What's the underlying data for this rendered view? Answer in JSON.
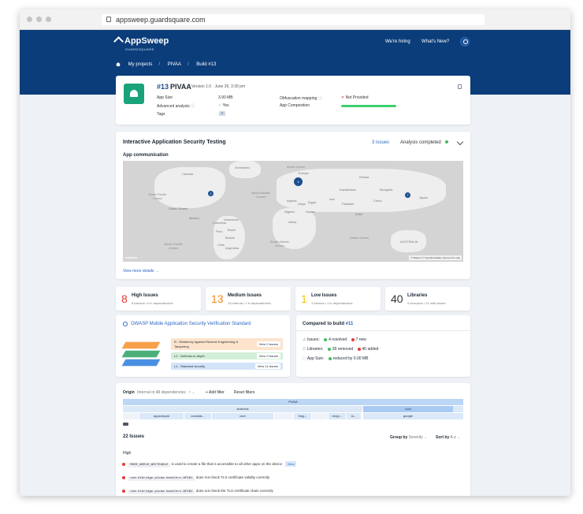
{
  "browser": {
    "url": "appsweep.guardsquare.com"
  },
  "header": {
    "logo": "AppSweep",
    "logo_sub": "GUARDSQUARE",
    "nav_hiring": "We're hiring",
    "nav_whats_new": "What's New?",
    "breadcrumb": [
      "My projects",
      "PIVAA",
      "Build #13"
    ]
  },
  "build": {
    "number": "#13",
    "name": "PIVAA",
    "version": "Version 1.0",
    "date": "June 26, 3:39 pm",
    "app_size_label": "App Size",
    "app_size": "3.90 MB",
    "advanced_label": "Advanced analysis",
    "advanced_value": "Yes",
    "tags_label": "Tags",
    "obf_label": "Obfuscation mapping",
    "obf_value": "Not Provided",
    "composition_label": "App Composition"
  },
  "iast": {
    "title": "Interactive Application Security Testing",
    "issues_link": "3 issues",
    "status": "Analysis completed",
    "subtitle": "App communication",
    "view_more": "View more details →",
    "map_attrib": "© Mapbox © OpenStreetMap Improve this map",
    "map_logo": "mapbox",
    "oceans": [
      "Arctic Ocean",
      "North Pacific Ocean",
      "North Atlantic Ocean",
      "South Atlantic Ocean",
      "South Pacific Ocean",
      "Indian Ocean"
    ],
    "places": [
      "Canada",
      "United States",
      "Mexico",
      "Brazil",
      "Europe",
      "Africa",
      "China",
      "India",
      "Russia",
      "Kazakhstan",
      "Japan",
      "AUSTRALIA",
      "Greenland",
      "Algeria",
      "Libya",
      "Egypt",
      "Sudan",
      "Nigeria",
      "Peru",
      "Bolivia",
      "Argentina",
      "Mongolia",
      "Iran",
      "Pakistan",
      "Colombia",
      "Venezuela",
      "Chile"
    ],
    "clusters": [
      "2",
      "4",
      "7"
    ]
  },
  "counts": [
    {
      "num": "8",
      "title": "High Issues",
      "sub": "8 internal • 0 in dependencies",
      "color": "#e53935"
    },
    {
      "num": "13",
      "title": "Medium Issues",
      "sub": "13 internal • 1 in dependencies",
      "color": "#f18a1e"
    },
    {
      "num": "1",
      "title": "Low Issues",
      "sub": "1 internal • 1 in dependencies",
      "color": "#f5c400"
    },
    {
      "num": "40",
      "title": "Libraries",
      "sub": "9 exclusive • 21 with issues",
      "color": "#333333"
    }
  ],
  "owasp": {
    "title": "OWASP Mobile Application Security Verification Standard",
    "rows": [
      {
        "label": "R - Resiliency Against Reverse Engineering & Tampering",
        "button": "View 2 issues"
      },
      {
        "label": "L2 - Defense-in-depth",
        "button": "View 9 issues"
      },
      {
        "label": "L1 - Standard security",
        "button": "View 11 issues"
      }
    ]
  },
  "compare": {
    "title": "Compared to build",
    "build": "#11",
    "issues_label": "Issues:",
    "issues_resolved": "4 resolved",
    "issues_new": "7 new",
    "libs_label": "Libraries:",
    "libs_removed": "39 removed",
    "libs_added": "40 added",
    "size_label": "App Size:",
    "size_value": "reduced by 0.00 MB"
  },
  "filters": {
    "origin_label": "Origin",
    "origin_value": "Internal or All dependencies",
    "add_filter": "Add filter",
    "reset": "Reset filters",
    "tree_root": "PIVAA",
    "tree_l2": [
      "androidx",
      "com"
    ],
    "tree_l3": [
      "appcompat",
      "constrai...",
      "core",
      "frag...",
      "recyc...",
      "lo...",
      "google"
    ]
  },
  "list": {
    "count": "22 Issues",
    "group_label": "Group by",
    "group_value": "Severity",
    "sort_label": "Sort by",
    "sort_value": "A-z",
    "section": "High",
    "rows": [
      {
        "code": "MODE_WORLD_WRITEABLE",
        "text": "is used to create a file that is accessible to all other apps on the device",
        "badge": "New"
      },
      {
        "code": "com.htbridge.pivaa.handlers.API$1",
        "text": "does not check TLS certificate validity correctly",
        "badge": ""
      },
      {
        "code": "com.htbridge.pivaa.handlers.API$2",
        "text": "does not check the TLS certificate chain correctly",
        "badge": ""
      }
    ]
  }
}
